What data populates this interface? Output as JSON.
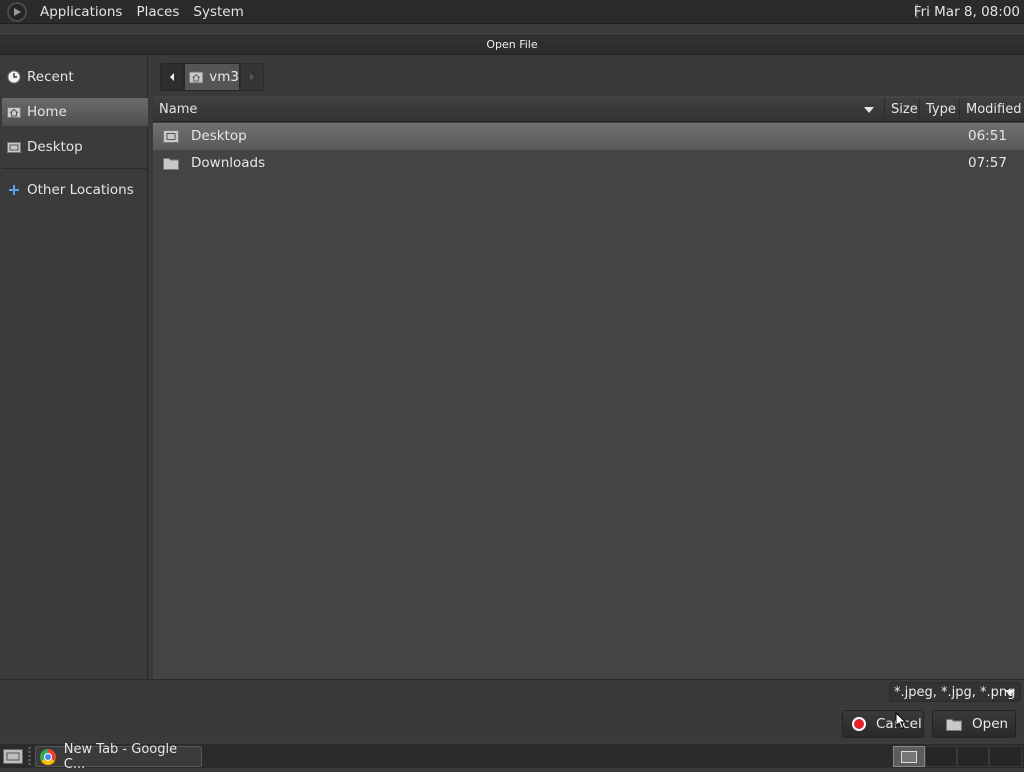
{
  "top_panel": {
    "menu": [
      "Applications",
      "Places",
      "System"
    ],
    "clock": "Fri Mar  8, 08:00"
  },
  "dialog": {
    "title": "Open File",
    "sidebar": {
      "items": [
        {
          "label": "Recent",
          "icon": "recent-icon"
        },
        {
          "label": "Home",
          "icon": "home-folder-icon",
          "selected": true
        },
        {
          "label": "Desktop",
          "icon": "desktop-folder-icon"
        },
        {
          "label": "Other Locations",
          "icon": "plus-icon"
        }
      ]
    },
    "pathbar": {
      "crumb": "vm3"
    },
    "columns": {
      "name": "Name",
      "size": "Size",
      "type": "Type",
      "modified": "Modified"
    },
    "files": [
      {
        "name": "Desktop",
        "modified": "06:51",
        "icon": "desktop-folder-icon",
        "selected": true
      },
      {
        "name": "Downloads",
        "modified": "07:57",
        "icon": "folder-icon",
        "selected": false
      }
    ],
    "filter": "*.jpeg, *.jpg, *.png",
    "buttons": {
      "cancel": "Cancel",
      "open": "Open"
    }
  },
  "taskbar": {
    "task_label": "New Tab - Google C..."
  },
  "colors": {
    "selection": "#646464",
    "cancel_icon": "#e8202a"
  }
}
